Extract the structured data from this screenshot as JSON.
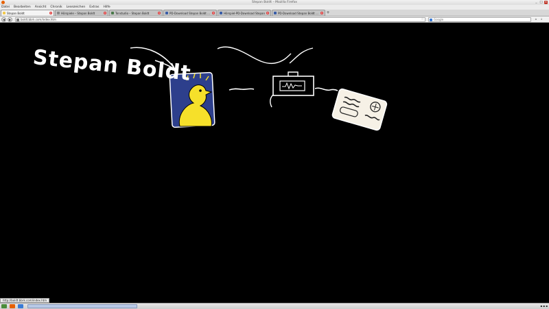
{
  "window": {
    "title": "Stepan Boldt – Mozilla Firefox",
    "controls": [
      "_",
      "□",
      "×"
    ]
  },
  "menubar": [
    "Datei",
    "Bearbeiten",
    "Ansicht",
    "Chronik",
    "Lesezeichen",
    "Extras",
    "Hilfe"
  ],
  "tabs": [
    {
      "label": "Stepan Boldt",
      "favicon_color": "#f2c94c",
      "active": true
    },
    {
      "label": "Hörspiele – Stepan Boldt",
      "favicon_color": "#888888",
      "active": false
    },
    {
      "label": "Tonstudio – Stepan Boldt",
      "favicon_color": "#4a7a4a",
      "active": false
    },
    {
      "label": "PD-Download Stepan Boldt ...",
      "favicon_color": "#3a5ea8",
      "active": false
    },
    {
      "label": "Hörspiel-PD-Download Stepan ...",
      "favicon_color": "#3a5ea8",
      "active": false
    },
    {
      "label": "PD-Download Stepan Boldt ...",
      "favicon_color": "#3a5ea8",
      "active": false
    }
  ],
  "new_tab_label": "+",
  "navbar": {
    "url": "boldt.bbrk.com/index.htm",
    "search_placeholder": "Google"
  },
  "page": {
    "site_title": "Stepan Boldt",
    "status_url": "http://boldt.bbrk.com/index.htm"
  },
  "colors": {
    "background": "#000000",
    "duck_yellow": "#f6e02a",
    "duck_frame": "#2d3f8c",
    "card_bg": "#f6f1e6"
  },
  "icons": {
    "duck_picture": "duck-portrait-icon",
    "radio_device": "radio-device-icon",
    "business_card": "business-card-icon"
  }
}
